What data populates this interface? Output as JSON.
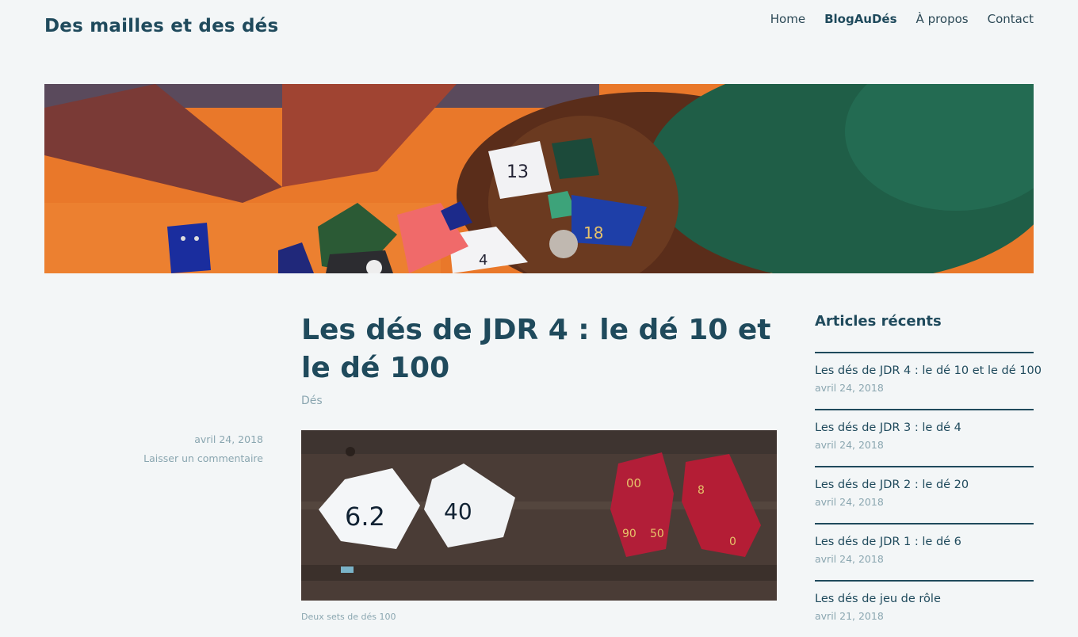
{
  "site": {
    "title": "Des mailles et des dés"
  },
  "nav": {
    "items": [
      {
        "label": "Home",
        "active": false
      },
      {
        "label": "BlogAuDés",
        "active": true
      },
      {
        "label": "À propos",
        "active": false
      },
      {
        "label": "Contact",
        "active": false
      }
    ]
  },
  "post": {
    "title": "Les dés de JDR 4 : le dé 10 et le dé 100",
    "category": "Dés",
    "date": "avril 24, 2018",
    "comment_link": "Laisser un commentaire",
    "image_caption": "Deux sets de dés 100"
  },
  "sidebar": {
    "widget_title": "Articles récents",
    "recent": [
      {
        "title": "Les dés de JDR 4 : le dé 10 et le dé 100",
        "date": "avril 24, 2018"
      },
      {
        "title": "Les dés de JDR 3 : le dé 4",
        "date": "avril 24, 2018"
      },
      {
        "title": "Les dés de JDR 2 : le dé 20",
        "date": "avril 24, 2018"
      },
      {
        "title": "Les dés de JDR 1 : le dé 6",
        "date": "avril 24, 2018"
      },
      {
        "title": "Les dés de jeu de rôle",
        "date": "avril 21, 2018"
      }
    ]
  }
}
